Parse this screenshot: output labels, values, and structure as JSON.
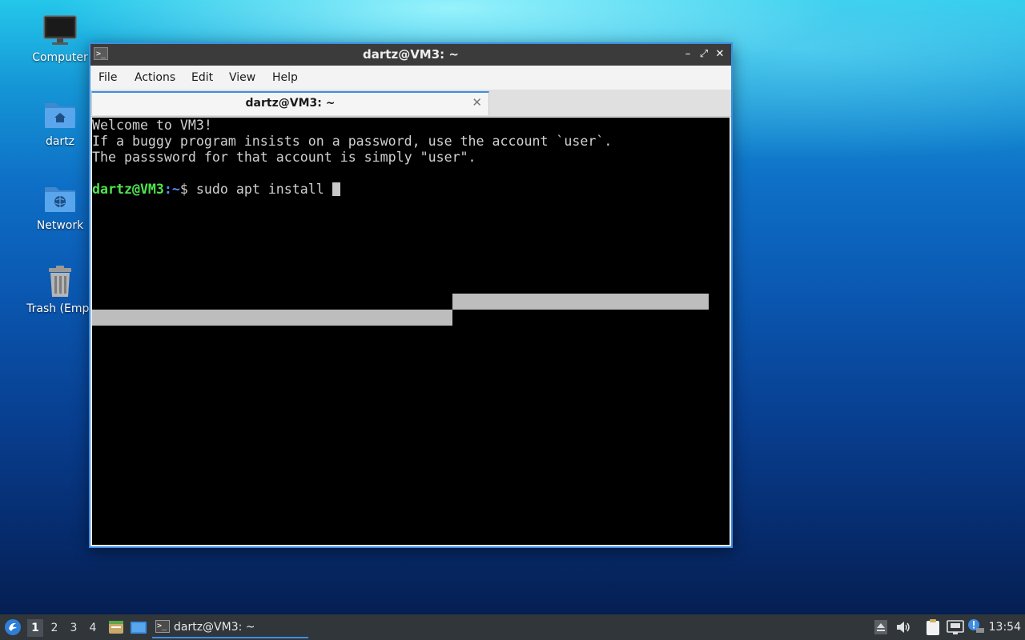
{
  "desktop": {
    "icons": [
      {
        "label": "Computer",
        "icon": "monitor-icon"
      },
      {
        "label": "dartz",
        "icon": "home-folder-icon"
      },
      {
        "label": "Network",
        "icon": "network-folder-icon"
      },
      {
        "label": "Trash (Empt",
        "icon": "trash-icon"
      }
    ]
  },
  "window": {
    "title": "dartz@VM3: ~",
    "menu": [
      "File",
      "Actions",
      "Edit",
      "View",
      "Help"
    ],
    "tab_title": "dartz@VM3: ~",
    "app_icon_glyph": ">_",
    "minimize_glyph": "–",
    "maximize_glyph": "⤢",
    "close_glyph": "✕",
    "tab_close_glyph": "✕"
  },
  "terminal": {
    "lines": [
      "Welcome to VM3!",
      "If a buggy program insists on a password, use the account `user`.",
      "The passsword for that account is simply \"user\"."
    ],
    "prompt_user": "dartz@VM3",
    "prompt_sep": ":",
    "prompt_path": "~",
    "prompt_symbol": "$ ",
    "command": "sudo apt install ",
    "colors": {
      "background": "#000000",
      "foreground": "#d0d0d0",
      "prompt_user": "#4ee44e",
      "prompt_path": "#5a8fff"
    }
  },
  "taskbar": {
    "workspaces": [
      "1",
      "2",
      "3",
      "4"
    ],
    "active_workspace": "1",
    "task_label": "dartz@VM3: ~",
    "clock": "13:54",
    "tray_icons": [
      "eject-icon",
      "volume-icon",
      "clipboard-icon",
      "network-icon",
      "update-notifier-icon"
    ]
  },
  "accent_color": "#3d8ee3"
}
